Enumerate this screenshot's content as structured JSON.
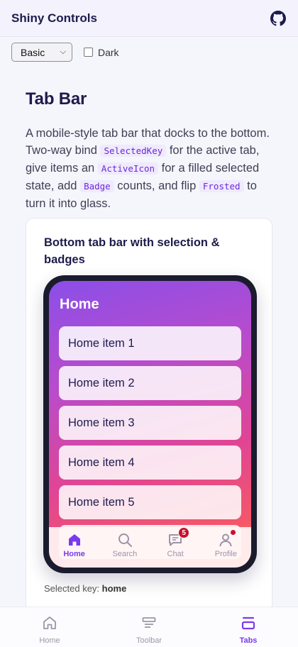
{
  "app": {
    "title": "Shiny Controls",
    "github_icon": "github-icon"
  },
  "controls": {
    "theme_select": {
      "value": "Basic"
    },
    "dark_toggle": {
      "label": "Dark",
      "checked": false
    }
  },
  "section": {
    "title": "Tab Bar",
    "desc_1": "A mobile-style tab bar that docks to the bottom. Two-way bind ",
    "code_1": "SelectedKey",
    "desc_2": " for the active tab, give items an ",
    "code_2": "ActiveIcon",
    "desc_3": " for a filled selected state, add ",
    "code_3": "Badge",
    "desc_4": " counts, and flip ",
    "code_4": "Frosted",
    "desc_5": " to turn it into glass."
  },
  "demo": {
    "card_title": "Bottom tab bar with selection & badges",
    "screen_title": "Home",
    "items": [
      "Home item 1",
      "Home item 2",
      "Home item 3",
      "Home item 4",
      "Home item 5"
    ],
    "tabs": [
      {
        "label": "Home",
        "icon": "home-icon",
        "active": true
      },
      {
        "label": "Search",
        "icon": "search-icon",
        "active": false
      },
      {
        "label": "Chat",
        "icon": "chat-icon",
        "active": false,
        "badge": "5"
      },
      {
        "label": "Profile",
        "icon": "profile-icon",
        "active": false,
        "dot": true
      }
    ],
    "selected_key_label": "Selected key:",
    "selected_key_value": "home"
  },
  "bottom_nav": [
    {
      "label": "Home",
      "icon": "home-icon",
      "active": false
    },
    {
      "label": "Toolbar",
      "icon": "toolbar-icon",
      "active": false
    },
    {
      "label": "Tabs",
      "icon": "tabs-icon",
      "active": true
    }
  ],
  "colors": {
    "accent": "#7c3aed",
    "badge": "#c8102e",
    "title": "#1e1b4b"
  }
}
